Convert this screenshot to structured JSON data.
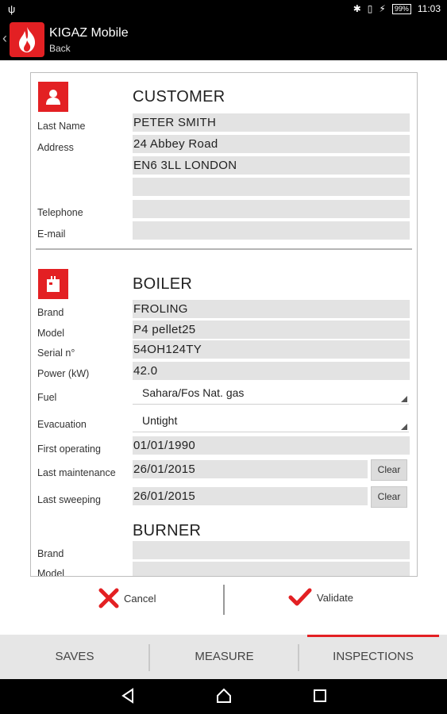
{
  "status_bar": {
    "usb_icon": "usb-icon",
    "battery": "99%",
    "time": "11:03"
  },
  "app": {
    "title": "KIGAZ Mobile",
    "subtitle": "Back",
    "brand_color": "#e32023"
  },
  "customer": {
    "title": "CUSTOMER",
    "labels": {
      "last_name": "Last Name",
      "address": "Address",
      "telephone": "Telephone",
      "email": "E-mail"
    },
    "values": {
      "last_name": "PETER SMITH",
      "address1": "24 Abbey Road",
      "address2": "EN6 3LL LONDON",
      "address3": "",
      "telephone": "",
      "email": ""
    }
  },
  "boiler": {
    "title": "BOILER",
    "labels": {
      "brand": "Brand",
      "model": "Model",
      "serial": "Serial n°",
      "power": "Power (kW)",
      "fuel": "Fuel",
      "evacuation": "Evacuation",
      "first_operating": "First operating",
      "last_maintenance": "Last maintenance",
      "last_sweeping": "Last sweeping"
    },
    "values": {
      "brand": "FROLING",
      "model": "P4 pellet25",
      "serial": "54OH124TY",
      "power": "42.0",
      "fuel": "Sahara/Fos Nat. gas",
      "evacuation": "Untight",
      "first_operating": "01/01/1990",
      "last_maintenance": "26/01/2015",
      "last_sweeping": "26/01/2015"
    },
    "clear_label": "Clear"
  },
  "burner": {
    "title": "BURNER",
    "labels": {
      "brand": "Brand",
      "model": "Model"
    },
    "values": {
      "brand": "",
      "model": ""
    }
  },
  "actions": {
    "cancel": "Cancel",
    "validate": "Validate"
  },
  "tabs": {
    "saves": "SAVES",
    "measure": "MEASURE",
    "inspections": "INSPECTIONS"
  }
}
